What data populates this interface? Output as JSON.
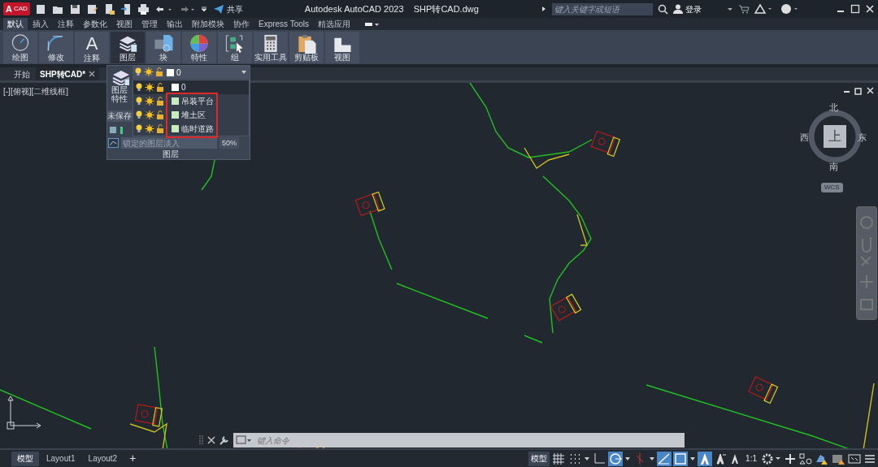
{
  "title_bar": {
    "logo_letter": "A",
    "logo_sub": "CAD",
    "share": "共享",
    "title": "Autodesk AutoCAD 2023    SHP转CAD.dwg",
    "search": {
      "placeholder": "键入关键字或短语"
    },
    "login": "登录"
  },
  "ribbon_tabs": [
    {
      "label": "默认",
      "selected": true
    },
    {
      "label": "插入",
      "selected": false
    },
    {
      "label": "注释",
      "selected": false
    },
    {
      "label": "参数化",
      "selected": false
    },
    {
      "label": "视图",
      "selected": false
    },
    {
      "label": "管理",
      "selected": false
    },
    {
      "label": "输出",
      "selected": false
    },
    {
      "label": "附加模块",
      "selected": false
    },
    {
      "label": "协作",
      "selected": false
    },
    {
      "label": "Express Tools",
      "selected": false
    },
    {
      "label": "精选应用",
      "selected": false
    }
  ],
  "ribbon_panels": [
    {
      "label": "绘图",
      "kind": "draw",
      "selected": false
    },
    {
      "label": "修改",
      "kind": "modify",
      "selected": false
    },
    {
      "label": "注释",
      "kind": "annotate",
      "glyph": "A",
      "selected": false
    },
    {
      "label": "图层",
      "kind": "layers",
      "selected": true
    },
    {
      "label": "块",
      "kind": "block",
      "selected": false
    },
    {
      "label": "特性",
      "kind": "properties",
      "selected": false
    },
    {
      "label": "组",
      "kind": "group",
      "selected": false
    },
    {
      "label": "实用工具",
      "kind": "utilities",
      "selected": false
    },
    {
      "label": "剪贴板",
      "kind": "clipboard",
      "selected": false
    },
    {
      "label": "视图",
      "kind": "view",
      "selected": false
    }
  ],
  "doc_tabs": [
    {
      "label": "开始",
      "selected": false
    },
    {
      "label": "SHP转CAD*",
      "selected": true
    }
  ],
  "viewport_label": "[-][俯视][二维线框]",
  "layer_panel": {
    "properties_label": "图层特性",
    "unsaved": "未保存",
    "current_layer": "0",
    "lock_fade": {
      "placeholder": "锁定的图层淡入",
      "value": "50%"
    },
    "footer": "图层",
    "layers": [
      {
        "name": "0",
        "color": "#ffffff",
        "selected": true
      },
      {
        "name": "吊装平台",
        "color": "#c8ecc0",
        "selected": false
      },
      {
        "name": "堆土区",
        "color": "#c8ecc0",
        "selected": false
      },
      {
        "name": "临时道路",
        "color": "#c8ecc0",
        "selected": false
      }
    ]
  },
  "viewcube": {
    "north": "北",
    "south": "南",
    "east": "东",
    "west": "西",
    "face": "上",
    "ucs": "WCS"
  },
  "command_line": {
    "placeholder": "键入命令"
  },
  "layout_tabs": [
    {
      "label": "模型",
      "selected": true
    },
    {
      "label": "Layout1",
      "selected": false
    },
    {
      "label": "Layout2",
      "selected": false
    }
  ],
  "add_layout": "+",
  "status_bar": {
    "model": "模型",
    "scale": "1:1",
    "toggles": [
      {
        "kind": "grid",
        "on": false
      },
      {
        "kind": "snap",
        "on": false
      },
      {
        "kind": "ortho",
        "on": false
      },
      {
        "kind": "polar",
        "on": true
      },
      {
        "kind": "isodraft",
        "on": false
      },
      {
        "kind": "tracking",
        "on": true
      },
      {
        "kind": "osnap",
        "on": true
      },
      {
        "kind": "annotation",
        "on": true
      }
    ]
  }
}
